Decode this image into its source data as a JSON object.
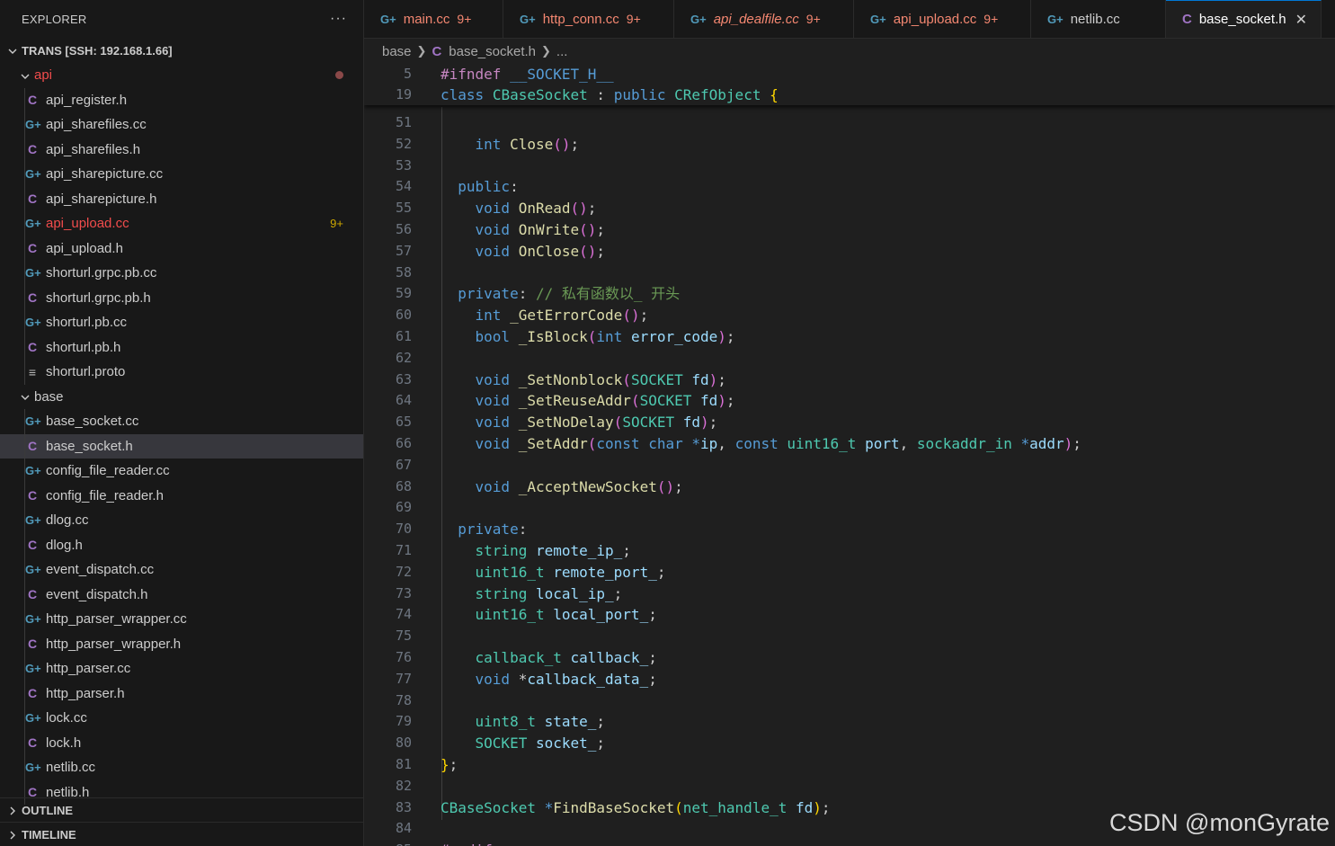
{
  "explorer": {
    "title": "EXPLORER",
    "more_label": "···",
    "workspace": "TRANS [SSH: 192.168.1.66]",
    "folders": [
      {
        "name": "api",
        "items": [
          {
            "name": "api_register.h",
            "kind": "c"
          },
          {
            "name": "api_sharefiles.cc",
            "kind": "cpp"
          },
          {
            "name": "api_sharefiles.h",
            "kind": "c"
          },
          {
            "name": "api_sharepicture.cc",
            "kind": "cpp"
          },
          {
            "name": "api_sharepicture.h",
            "kind": "c"
          },
          {
            "name": "api_upload.cc",
            "kind": "cpp",
            "badge": "9+"
          },
          {
            "name": "api_upload.h",
            "kind": "c"
          },
          {
            "name": "shorturl.grpc.pb.cc",
            "kind": "cpp"
          },
          {
            "name": "shorturl.grpc.pb.h",
            "kind": "c"
          },
          {
            "name": "shorturl.pb.cc",
            "kind": "cpp"
          },
          {
            "name": "shorturl.pb.h",
            "kind": "c"
          },
          {
            "name": "shorturl.proto",
            "kind": "proto"
          }
        ]
      },
      {
        "name": "base",
        "items": [
          {
            "name": "base_socket.cc",
            "kind": "cpp"
          },
          {
            "name": "base_socket.h",
            "kind": "c",
            "selected": true
          },
          {
            "name": "config_file_reader.cc",
            "kind": "cpp"
          },
          {
            "name": "config_file_reader.h",
            "kind": "c"
          },
          {
            "name": "dlog.cc",
            "kind": "cpp"
          },
          {
            "name": "dlog.h",
            "kind": "c"
          },
          {
            "name": "event_dispatch.cc",
            "kind": "cpp"
          },
          {
            "name": "event_dispatch.h",
            "kind": "c"
          },
          {
            "name": "http_parser_wrapper.cc",
            "kind": "cpp"
          },
          {
            "name": "http_parser_wrapper.h",
            "kind": "c"
          },
          {
            "name": "http_parser.cc",
            "kind": "cpp"
          },
          {
            "name": "http_parser.h",
            "kind": "c"
          },
          {
            "name": "lock.cc",
            "kind": "cpp"
          },
          {
            "name": "lock.h",
            "kind": "c"
          },
          {
            "name": "netlib.cc",
            "kind": "cpp"
          },
          {
            "name": "netlib.h",
            "kind": "c"
          }
        ]
      }
    ],
    "outline": "OUTLINE",
    "timeline": "TIMELINE"
  },
  "tabs": [
    {
      "label": "main.cc",
      "kind": "cpp",
      "badge": "9+",
      "error": true
    },
    {
      "label": "http_conn.cc",
      "kind": "cpp",
      "badge": "9+",
      "error": true
    },
    {
      "label": "api_dealfile.cc",
      "kind": "cpp",
      "badge": "9+",
      "error": true,
      "italic": true
    },
    {
      "label": "api_upload.cc",
      "kind": "cpp",
      "badge": "9+",
      "error": true
    },
    {
      "label": "netlib.cc",
      "kind": "cpp"
    },
    {
      "label": "base_socket.h",
      "kind": "c",
      "active": true
    }
  ],
  "breadcrumb": {
    "folder": "base",
    "file": "base_socket.h",
    "tail": "..."
  },
  "icons": {
    "c_glyph": "C",
    "cpp_glyph": "G+",
    "proto_glyph": "≡",
    "close_glyph": "✕"
  },
  "sticky_lines": [
    {
      "n": "5",
      "tokens": [
        [
          "pp",
          "#ifndef"
        ],
        [
          "",
          " "
        ],
        [
          "mc",
          "__SOCKET_H__"
        ]
      ]
    },
    {
      "n": "19",
      "tokens": [
        [
          "kw",
          "class"
        ],
        [
          "",
          " "
        ],
        [
          "ty",
          "CBaseSocket"
        ],
        [
          "",
          " : "
        ],
        [
          "kw",
          "public"
        ],
        [
          "",
          " "
        ],
        [
          "ty",
          "CRefObject"
        ],
        [
          "",
          " "
        ],
        [
          "br1",
          "{"
        ]
      ]
    }
  ],
  "code_lines": [
    {
      "n": "51",
      "tokens": []
    },
    {
      "n": "52",
      "tokens": [
        [
          "",
          "    "
        ],
        [
          "kw",
          "int"
        ],
        [
          "",
          " "
        ],
        [
          "fn",
          "Close"
        ],
        [
          "br2",
          "()"
        ],
        [
          "",
          ";"
        ]
      ]
    },
    {
      "n": "53",
      "tokens": []
    },
    {
      "n": "54",
      "tokens": [
        [
          "",
          "  "
        ],
        [
          "kw",
          "public"
        ],
        [
          "",
          ":"
        ]
      ]
    },
    {
      "n": "55",
      "tokens": [
        [
          "",
          "    "
        ],
        [
          "kw",
          "void"
        ],
        [
          "",
          " "
        ],
        [
          "fn",
          "OnRead"
        ],
        [
          "br2",
          "()"
        ],
        [
          "",
          ";"
        ]
      ]
    },
    {
      "n": "56",
      "tokens": [
        [
          "",
          "    "
        ],
        [
          "kw",
          "void"
        ],
        [
          "",
          " "
        ],
        [
          "fn",
          "OnWrite"
        ],
        [
          "br2",
          "()"
        ],
        [
          "",
          ";"
        ]
      ]
    },
    {
      "n": "57",
      "tokens": [
        [
          "",
          "    "
        ],
        [
          "kw",
          "void"
        ],
        [
          "",
          " "
        ],
        [
          "fn",
          "OnClose"
        ],
        [
          "br2",
          "()"
        ],
        [
          "",
          ";"
        ]
      ]
    },
    {
      "n": "58",
      "tokens": []
    },
    {
      "n": "59",
      "tokens": [
        [
          "",
          "  "
        ],
        [
          "kw",
          "private"
        ],
        [
          "",
          ": "
        ],
        [
          "cm",
          "// 私有函数以_ 开头"
        ]
      ]
    },
    {
      "n": "60",
      "tokens": [
        [
          "",
          "    "
        ],
        [
          "kw",
          "int"
        ],
        [
          "",
          " "
        ],
        [
          "fn",
          "_GetErrorCode"
        ],
        [
          "br2",
          "()"
        ],
        [
          "",
          ";"
        ]
      ]
    },
    {
      "n": "61",
      "tokens": [
        [
          "",
          "    "
        ],
        [
          "kw",
          "bool"
        ],
        [
          "",
          " "
        ],
        [
          "fn",
          "_IsBlock"
        ],
        [
          "br2",
          "("
        ],
        [
          "kw",
          "int"
        ],
        [
          "",
          " "
        ],
        [
          "va",
          "error_code"
        ],
        [
          "br2",
          ")"
        ],
        [
          "",
          ";"
        ]
      ]
    },
    {
      "n": "62",
      "tokens": []
    },
    {
      "n": "63",
      "tokens": [
        [
          "",
          "    "
        ],
        [
          "kw",
          "void"
        ],
        [
          "",
          " "
        ],
        [
          "fn",
          "_SetNonblock"
        ],
        [
          "br2",
          "("
        ],
        [
          "ty",
          "SOCKET"
        ],
        [
          "",
          " "
        ],
        [
          "va",
          "fd"
        ],
        [
          "br2",
          ")"
        ],
        [
          "",
          ";"
        ]
      ]
    },
    {
      "n": "64",
      "tokens": [
        [
          "",
          "    "
        ],
        [
          "kw",
          "void"
        ],
        [
          "",
          " "
        ],
        [
          "fn",
          "_SetReuseAddr"
        ],
        [
          "br2",
          "("
        ],
        [
          "ty",
          "SOCKET"
        ],
        [
          "",
          " "
        ],
        [
          "va",
          "fd"
        ],
        [
          "br2",
          ")"
        ],
        [
          "",
          ";"
        ]
      ]
    },
    {
      "n": "65",
      "tokens": [
        [
          "",
          "    "
        ],
        [
          "kw",
          "void"
        ],
        [
          "",
          " "
        ],
        [
          "fn",
          "_SetNoDelay"
        ],
        [
          "br2",
          "("
        ],
        [
          "ty",
          "SOCKET"
        ],
        [
          "",
          " "
        ],
        [
          "va",
          "fd"
        ],
        [
          "br2",
          ")"
        ],
        [
          "",
          ";"
        ]
      ]
    },
    {
      "n": "66",
      "tokens": [
        [
          "",
          "    "
        ],
        [
          "kw",
          "void"
        ],
        [
          "",
          " "
        ],
        [
          "fn",
          "_SetAddr"
        ],
        [
          "br2",
          "("
        ],
        [
          "kw",
          "const"
        ],
        [
          "",
          " "
        ],
        [
          "kw",
          "char"
        ],
        [
          "",
          " "
        ],
        [
          "kw",
          "*"
        ],
        [
          "va",
          "ip"
        ],
        [
          "",
          ", "
        ],
        [
          "kw",
          "const"
        ],
        [
          "",
          " "
        ],
        [
          "ty",
          "uint16_t"
        ],
        [
          "",
          " "
        ],
        [
          "va",
          "port"
        ],
        [
          "",
          ", "
        ],
        [
          "ty",
          "sockaddr_in"
        ],
        [
          "",
          " "
        ],
        [
          "kw",
          "*"
        ],
        [
          "va",
          "addr"
        ],
        [
          "br2",
          ")"
        ],
        [
          "",
          ";"
        ]
      ]
    },
    {
      "n": "67",
      "tokens": []
    },
    {
      "n": "68",
      "tokens": [
        [
          "",
          "    "
        ],
        [
          "kw",
          "void"
        ],
        [
          "",
          " "
        ],
        [
          "fn",
          "_AcceptNewSocket"
        ],
        [
          "br2",
          "()"
        ],
        [
          "",
          ";"
        ]
      ]
    },
    {
      "n": "69",
      "tokens": []
    },
    {
      "n": "70",
      "tokens": [
        [
          "",
          "  "
        ],
        [
          "kw",
          "private"
        ],
        [
          "",
          ":"
        ]
      ]
    },
    {
      "n": "71",
      "tokens": [
        [
          "",
          "    "
        ],
        [
          "ty",
          "string"
        ],
        [
          "",
          " "
        ],
        [
          "va",
          "remote_ip_"
        ],
        [
          "",
          ";"
        ]
      ]
    },
    {
      "n": "72",
      "tokens": [
        [
          "",
          "    "
        ],
        [
          "ty",
          "uint16_t"
        ],
        [
          "",
          " "
        ],
        [
          "va",
          "remote_port_"
        ],
        [
          "",
          ";"
        ]
      ]
    },
    {
      "n": "73",
      "tokens": [
        [
          "",
          "    "
        ],
        [
          "ty",
          "string"
        ],
        [
          "",
          " "
        ],
        [
          "va",
          "local_ip_"
        ],
        [
          "",
          ";"
        ]
      ]
    },
    {
      "n": "74",
      "tokens": [
        [
          "",
          "    "
        ],
        [
          "ty",
          "uint16_t"
        ],
        [
          "",
          " "
        ],
        [
          "va",
          "local_port_"
        ],
        [
          "",
          ";"
        ]
      ]
    },
    {
      "n": "75",
      "tokens": []
    },
    {
      "n": "76",
      "tokens": [
        [
          "",
          "    "
        ],
        [
          "ty",
          "callback_t"
        ],
        [
          "",
          " "
        ],
        [
          "va",
          "callback_"
        ],
        [
          "",
          ";"
        ]
      ]
    },
    {
      "n": "77",
      "tokens": [
        [
          "",
          "    "
        ],
        [
          "kw",
          "void"
        ],
        [
          "",
          " *"
        ],
        [
          "va",
          "callback_data_"
        ],
        [
          "",
          ";"
        ]
      ]
    },
    {
      "n": "78",
      "tokens": []
    },
    {
      "n": "79",
      "tokens": [
        [
          "",
          "    "
        ],
        [
          "ty",
          "uint8_t"
        ],
        [
          "",
          " "
        ],
        [
          "va",
          "state_"
        ],
        [
          "",
          ";"
        ]
      ]
    },
    {
      "n": "80",
      "tokens": [
        [
          "",
          "    "
        ],
        [
          "ty",
          "SOCKET"
        ],
        [
          "",
          " "
        ],
        [
          "va",
          "socket_"
        ],
        [
          "",
          ";"
        ]
      ]
    },
    {
      "n": "81",
      "tokens": [
        [
          "br1",
          "}"
        ],
        [
          "",
          ";"
        ]
      ]
    },
    {
      "n": "82",
      "tokens": []
    },
    {
      "n": "83",
      "tokens": [
        [
          "ty",
          "CBaseSocket"
        ],
        [
          "",
          " "
        ],
        [
          "kw",
          "*"
        ],
        [
          "fn",
          "FindBaseSocket"
        ],
        [
          "br1",
          "("
        ],
        [
          "ty",
          "net_handle_t"
        ],
        [
          "",
          " "
        ],
        [
          "va",
          "fd"
        ],
        [
          "br1",
          ")"
        ],
        [
          "",
          ";"
        ]
      ]
    },
    {
      "n": "84",
      "tokens": []
    },
    {
      "n": "85",
      "tokens": [
        [
          "pp",
          "#endif"
        ]
      ]
    }
  ],
  "watermark": "CSDN @monGyrate"
}
